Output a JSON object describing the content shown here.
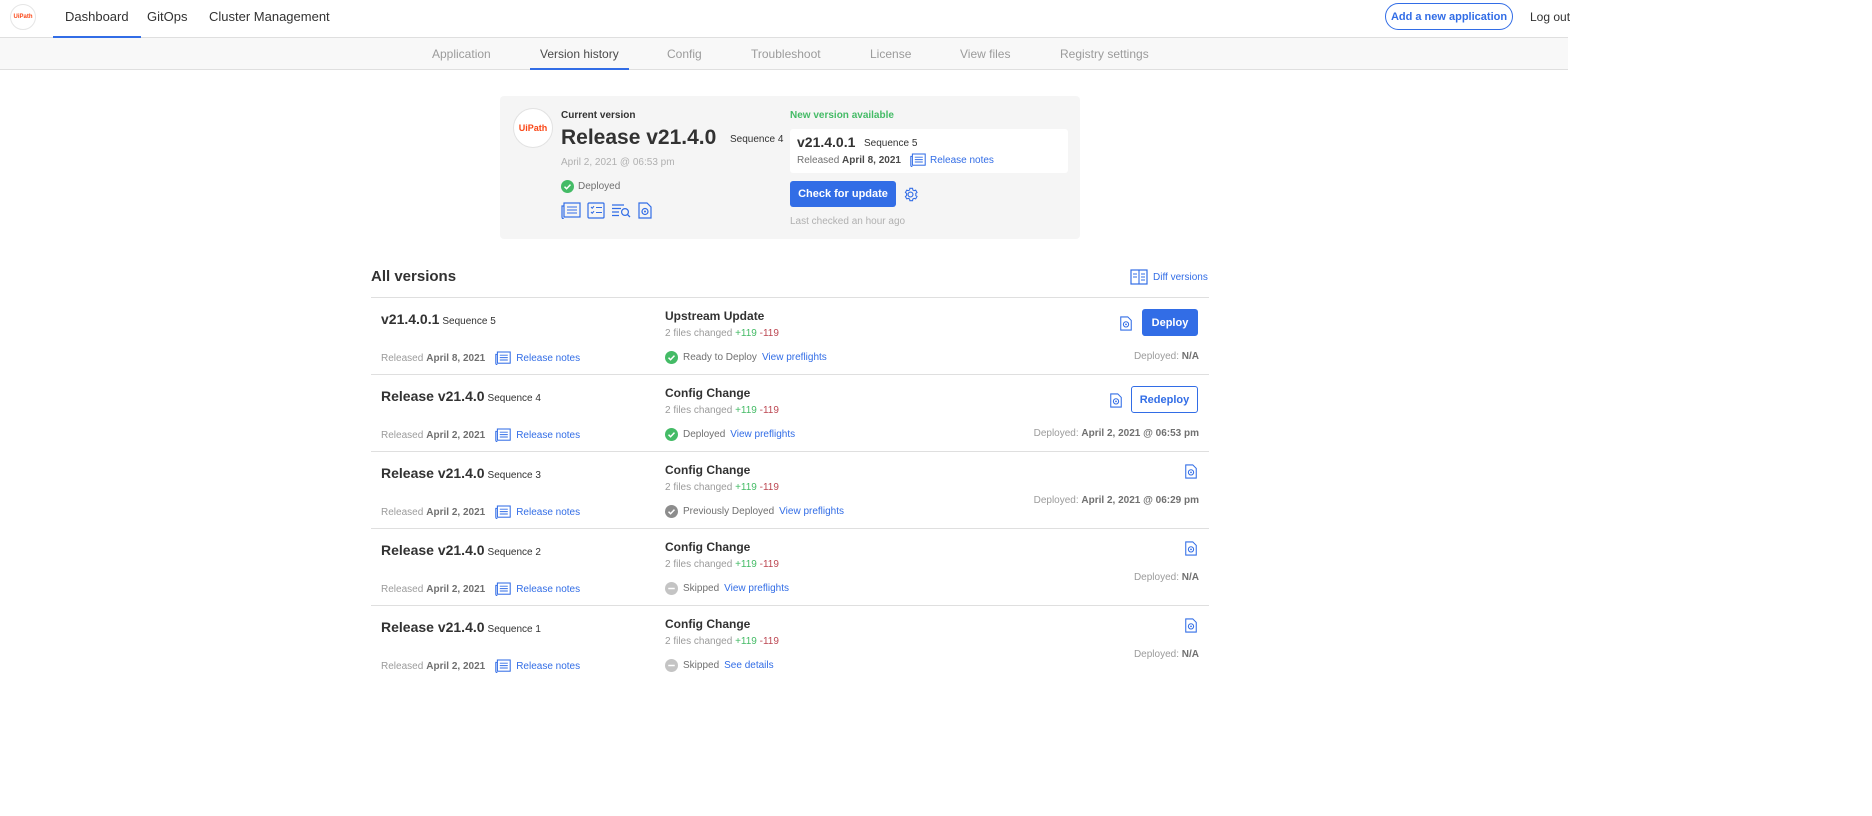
{
  "nav": {
    "items": [
      "Dashboard",
      "GitOps",
      "Cluster Management"
    ],
    "add_app": "Add a new application",
    "logout": "Log out"
  },
  "subnav": {
    "items": [
      "Application",
      "Version history",
      "Config",
      "Troubleshoot",
      "License",
      "View files",
      "Registry settings"
    ],
    "active": "Version history"
  },
  "current": {
    "label": "Current version",
    "title": "Release v21.4.0",
    "sequence": "Sequence 4",
    "date": "April 2, 2021 @ 06:53 pm",
    "status": "Deployed",
    "logo_text": "UiPath"
  },
  "new_version": {
    "label": "New version available",
    "version": "v21.4.0.1",
    "sequence": "Sequence 5",
    "released_prefix": "Released",
    "released_date": "April 8, 2021",
    "notes": "Release notes",
    "check_button": "Check for update",
    "last_checked": "Last checked an hour ago"
  },
  "versions": {
    "title": "All versions",
    "diff": "Diff versions",
    "rows": [
      {
        "title": "v21.4.0.1",
        "sequence": "Sequence 5",
        "released_prefix": "Released",
        "released_date": "April 8, 2021",
        "notes": "Release notes",
        "change": "Upstream Update",
        "files": "2 files changed",
        "plus": "+119",
        "minus": "-119",
        "status": "Ready to Deploy",
        "status_link": "View preflights",
        "deployed_prefix": "Deployed:",
        "deployed": "N/A",
        "button": "Deploy"
      },
      {
        "title": "Release v21.4.0",
        "sequence": "Sequence 4",
        "released_prefix": "Released",
        "released_date": "April 2, 2021",
        "notes": "Release notes",
        "change": "Config Change",
        "files": "2 files changed",
        "plus": "+119",
        "minus": "-119",
        "status": "Deployed",
        "status_link": "View preflights",
        "deployed_prefix": "Deployed:",
        "deployed": "April 2, 2021 @ 06:53 pm",
        "button": "Redeploy"
      },
      {
        "title": "Release v21.4.0",
        "sequence": "Sequence 3",
        "released_prefix": "Released",
        "released_date": "April 2, 2021",
        "notes": "Release notes",
        "change": "Config Change",
        "files": "2 files changed",
        "plus": "+119",
        "minus": "-119",
        "status": "Previously Deployed",
        "status_link": "View preflights",
        "deployed_prefix": "Deployed:",
        "deployed": "April 2, 2021 @ 06:29 pm"
      },
      {
        "title": "Release v21.4.0",
        "sequence": "Sequence 2",
        "released_prefix": "Released",
        "released_date": "April 2, 2021",
        "notes": "Release notes",
        "change": "Config Change",
        "files": "2 files changed",
        "plus": "+119",
        "minus": "-119",
        "status": "Skipped",
        "status_link": "View preflights",
        "deployed_prefix": "Deployed:",
        "deployed": "N/A"
      },
      {
        "title": "Release v21.4.0",
        "sequence": "Sequence 1",
        "released_prefix": "Released",
        "released_date": "April 2, 2021",
        "notes": "Release notes",
        "change": "Config Change",
        "files": "2 files changed",
        "plus": "+119",
        "minus": "-119",
        "status": "Skipped",
        "status_link": "See details",
        "deployed_prefix": "Deployed:",
        "deployed": "N/A"
      }
    ]
  },
  "colors": {
    "accent": "#326de6",
    "success": "#44bb66",
    "danger": "#bc4752",
    "muted": "#9b9b9b"
  }
}
